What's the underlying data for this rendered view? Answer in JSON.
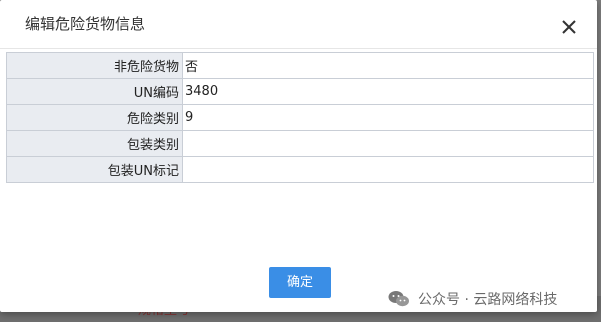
{
  "dialog": {
    "title": "编辑危险货物信息",
    "close_icon": "close-icon"
  },
  "fields": [
    {
      "label": "非危险货物",
      "value": "否"
    },
    {
      "label": "UN编码",
      "value": "3480"
    },
    {
      "label": "危险类别",
      "value": "9"
    },
    {
      "label": "包装类别",
      "value": ""
    },
    {
      "label": "包装UN标记",
      "value": ""
    }
  ],
  "footer": {
    "confirm_label": "确定"
  },
  "background": {
    "partial_label": "规格型号"
  },
  "watermark": {
    "icon": "wechat-icon",
    "text": "公众号 · 云路网络科技"
  },
  "colors": {
    "primary_button": "#3a8ee6",
    "label_cell_bg": "#e9ecf1",
    "border": "#c9ced6"
  }
}
